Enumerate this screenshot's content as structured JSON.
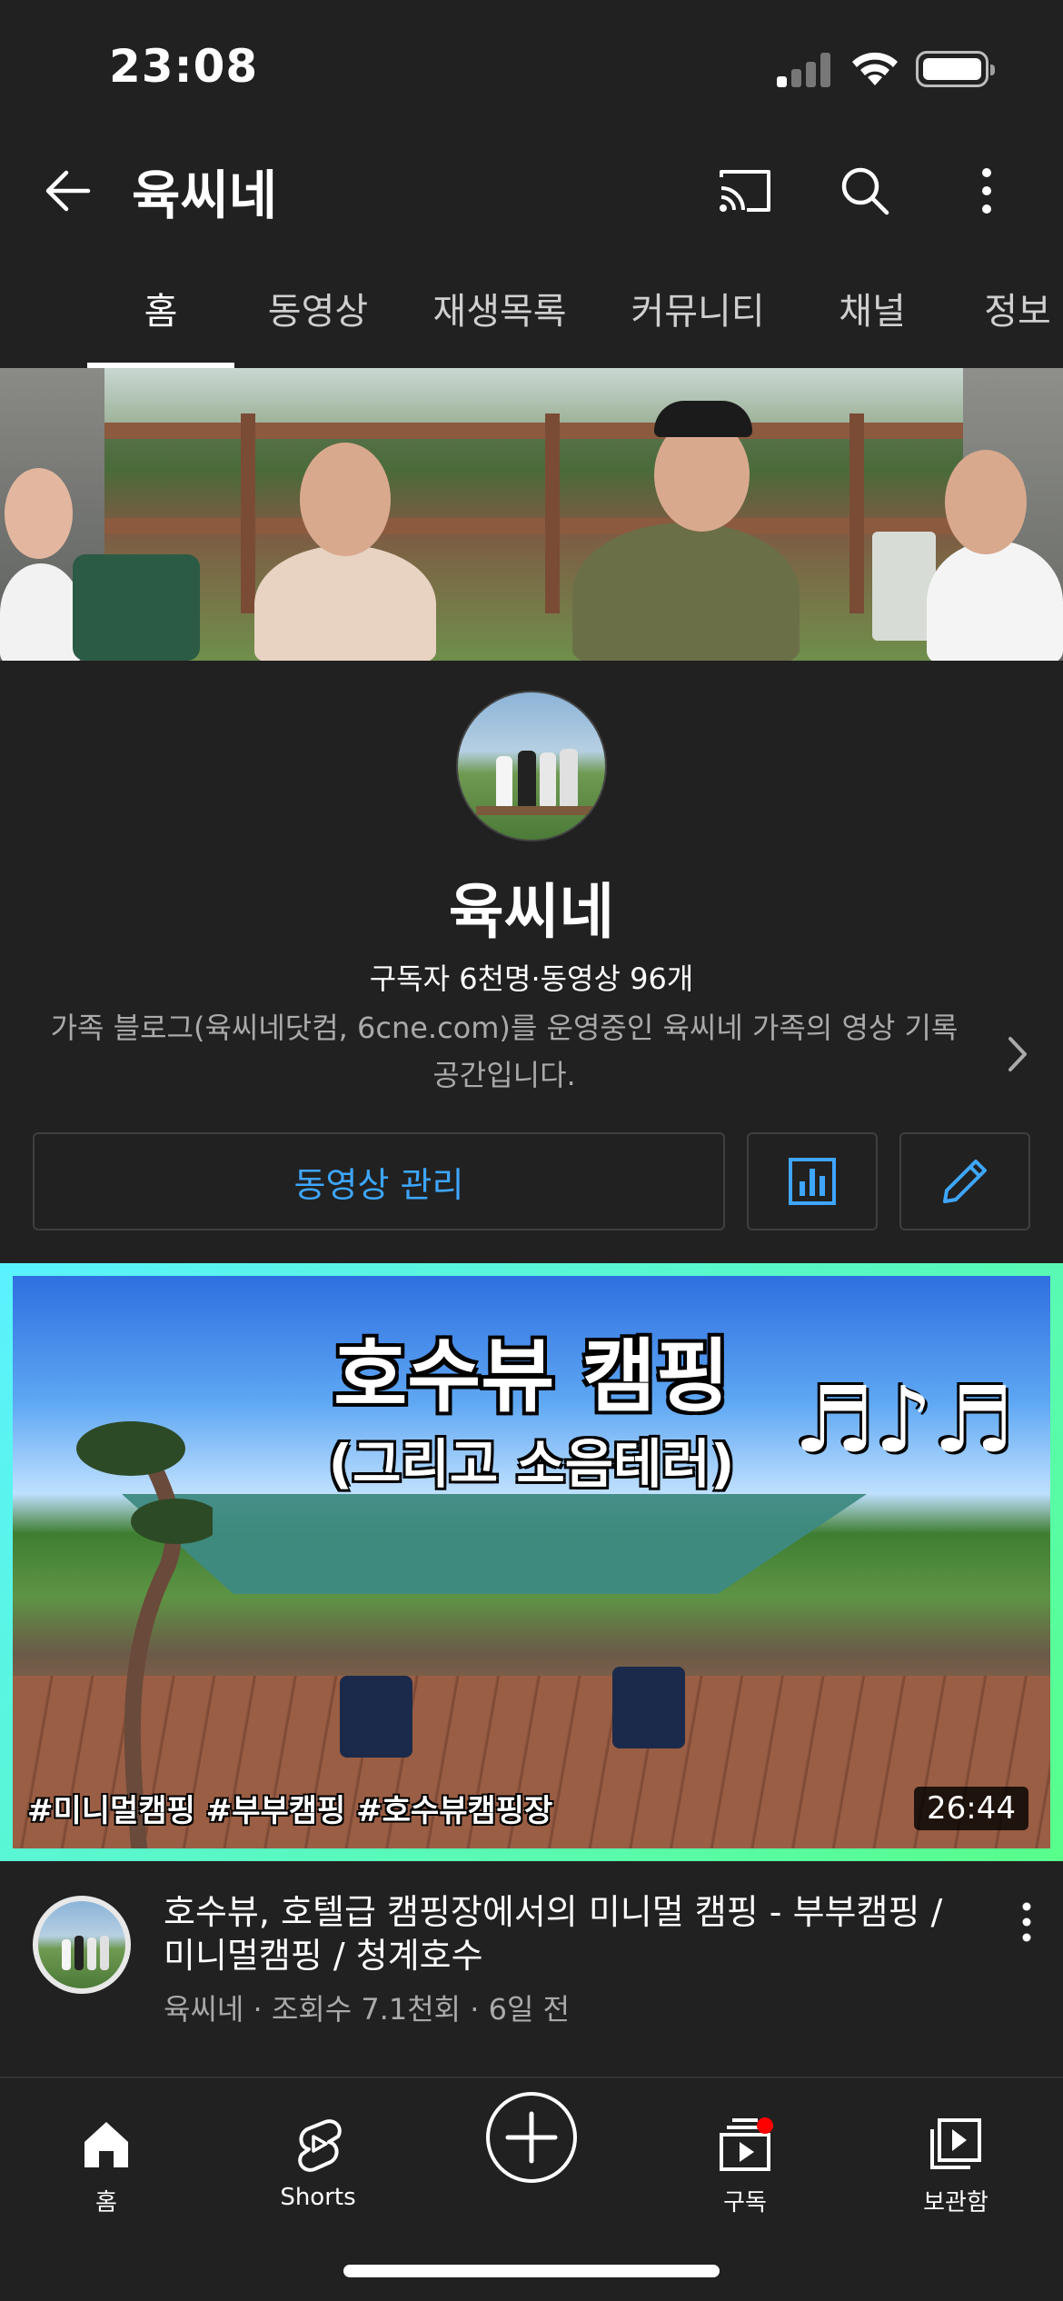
{
  "status_bar": {
    "time": "23:08"
  },
  "app_bar": {
    "title": "육씨네"
  },
  "tabs": [
    {
      "label": "홈",
      "active": true
    },
    {
      "label": "동영상",
      "active": false
    },
    {
      "label": "재생목록",
      "active": false
    },
    {
      "label": "커뮤니티",
      "active": false
    },
    {
      "label": "채널",
      "active": false
    },
    {
      "label": "정보",
      "active": false
    }
  ],
  "channel": {
    "name": "육씨네",
    "stats": "구독자 6천명·동영상 96개",
    "description": "가족 블로그(육씨네닷컴, 6cne.com)를 운영중인 육씨네 가족의 영상 기록 공간입니다."
  },
  "actions": {
    "manage_label": "동영상 관리"
  },
  "video": {
    "thumb_title": "호수뷰 캠핑",
    "thumb_subtitle": "(그리고 소음테러)",
    "thumb_notes": "♬♪♬",
    "thumb_tags": "#미니멀캠핑 #부부캠핑 #호수뷰캠핑장",
    "duration": "26:44",
    "title": "호수뷰, 호텔급 캠핑장에서의 미니멀 캠핑 - 부부캠핑 / 미니멀캠핑 / 청계호수",
    "meta": "육씨네 · 조회수 7.1천회 · 6일 전"
  },
  "bottom_nav": [
    {
      "label": "홈",
      "icon": "home-icon"
    },
    {
      "label": "Shorts",
      "icon": "shorts-icon"
    },
    {
      "label": "",
      "icon": "create-icon"
    },
    {
      "label": "구독",
      "icon": "subscriptions-icon"
    },
    {
      "label": "보관함",
      "icon": "library-icon"
    }
  ],
  "colors": {
    "accent": "#3ea6ff",
    "background": "#212121",
    "notification": "#ff0000"
  }
}
